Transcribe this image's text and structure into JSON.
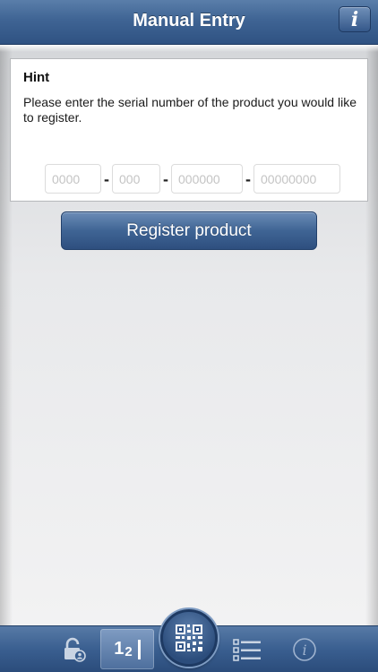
{
  "header": {
    "title": "Manual Entry",
    "info_icon": "info-icon",
    "info_glyph": "i"
  },
  "hint": {
    "title": "Hint",
    "text": "Please enter the serial number of the product you would like to register."
  },
  "serial": {
    "fields": [
      {
        "placeholder": "0000",
        "value": ""
      },
      {
        "placeholder": "000",
        "value": ""
      },
      {
        "placeholder": "000000",
        "value": ""
      },
      {
        "placeholder": "00000000",
        "value": ""
      }
    ],
    "separator": "-"
  },
  "register_button": {
    "label": "Register product"
  },
  "tabbar": {
    "tabs": [
      {
        "name": "lock-user-icon"
      },
      {
        "name": "numeric-entry-icon",
        "big": "1",
        "small": "2",
        "selected": true
      },
      {
        "name": "qr-code-icon"
      },
      {
        "name": "list-icon"
      },
      {
        "name": "info-circle-icon",
        "glyph": "i"
      }
    ]
  },
  "colors": {
    "header_blue": "#3f6494",
    "button_blue": "#3f6494",
    "tab_blue": "#3a5f90",
    "panel_bg": "#ffffff"
  }
}
